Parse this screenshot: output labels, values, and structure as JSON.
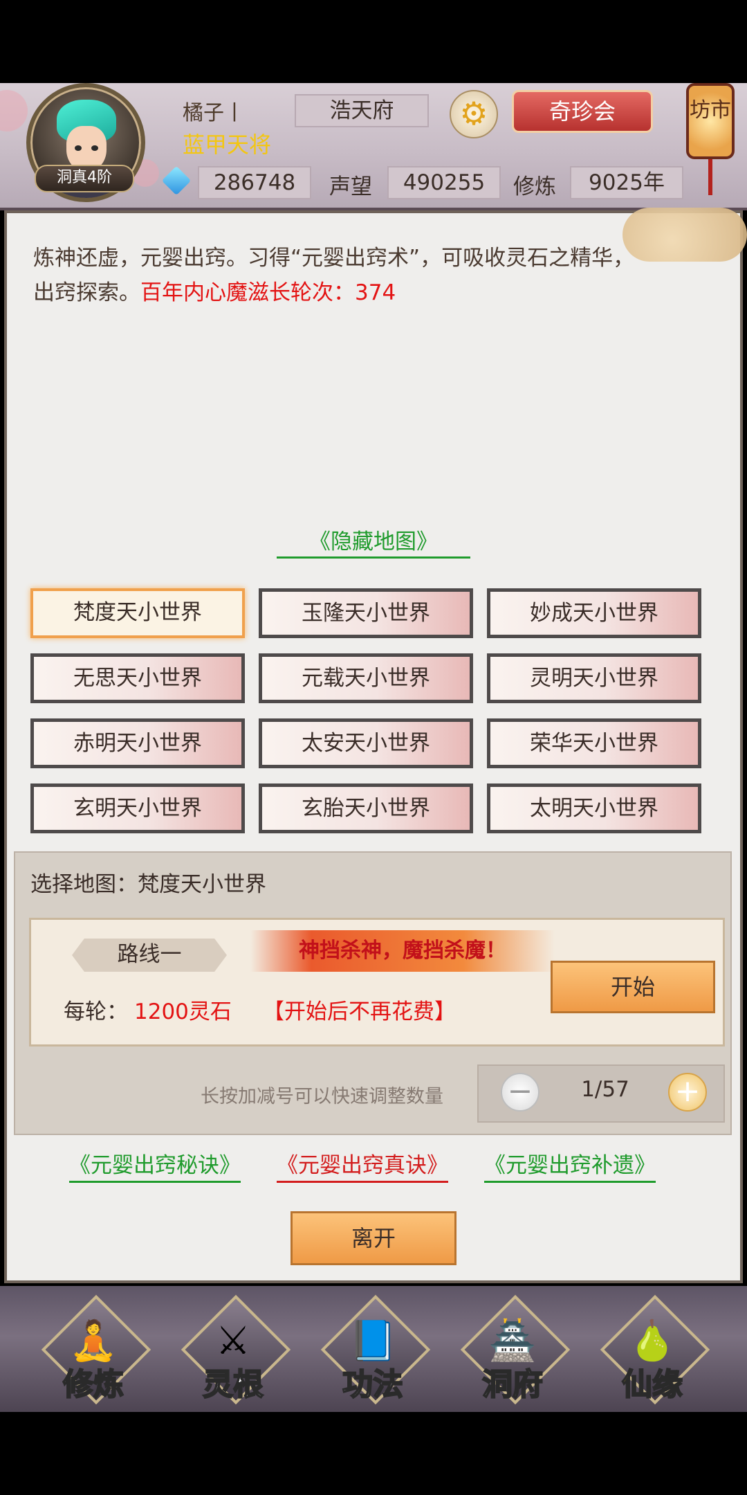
{
  "header": {
    "rank_badge": "洞真4阶",
    "player_name": "橘子丨",
    "player_title": "蓝甲天将",
    "realm_name": "浩天府",
    "treasure_button": "奇珍会",
    "market_lantern": "坊市",
    "spirit_stone": "286748",
    "fame_label": "声望",
    "fame": "490255",
    "training_label": "修炼",
    "training": "9025年"
  },
  "intro": {
    "text": "炼神还虚，元婴出窍。习得“元婴出窍术”，可吸收灵石之精华，出窍探索。",
    "highlight": "百年内心魔滋长轮次：374"
  },
  "hidden_map_link": "《隐藏地图》",
  "worlds": [
    "梵度天小世界",
    "玉隆天小世界",
    "妙成天小世界",
    "无思天小世界",
    "元载天小世界",
    "灵明天小世界",
    "赤明天小世界",
    "太安天小世界",
    "荣华天小世界",
    "玄明天小世界",
    "玄胎天小世界",
    "太明天小世界"
  ],
  "selected_world_index": 0,
  "selection": {
    "label": "选择地图：梵度天小世界",
    "route_name": "路线一",
    "slogan": "神挡杀神，魔挡杀魔！",
    "cost_label": "每轮：",
    "cost_value": "1200灵石",
    "cost_note": "【开始后不再花费】",
    "start_button": "开始",
    "hint": "长按加减号可以快速调整数量",
    "minus": "−",
    "plus": "+",
    "count": "1/57"
  },
  "links": [
    "《元婴出窍秘诀》",
    "《元婴出窍真诀》",
    "《元婴出窍补遗》"
  ],
  "leave_button": "离开",
  "nav": [
    {
      "label": "修炼",
      "icon": "meditation-icon",
      "glyph": "🧘"
    },
    {
      "label": "灵根",
      "icon": "sword-icon",
      "glyph": "⚔"
    },
    {
      "label": "功法",
      "icon": "book-icon",
      "glyph": "📘"
    },
    {
      "label": "洞府",
      "icon": "pagoda-icon",
      "glyph": "🏯"
    },
    {
      "label": "仙缘",
      "icon": "gourd-icon",
      "glyph": "🍐"
    }
  ],
  "colors": {
    "accent_red": "#e31313",
    "link_green": "#1f9b2c",
    "title_gold": "#f3c612",
    "button_orange": "#ef9a46"
  }
}
